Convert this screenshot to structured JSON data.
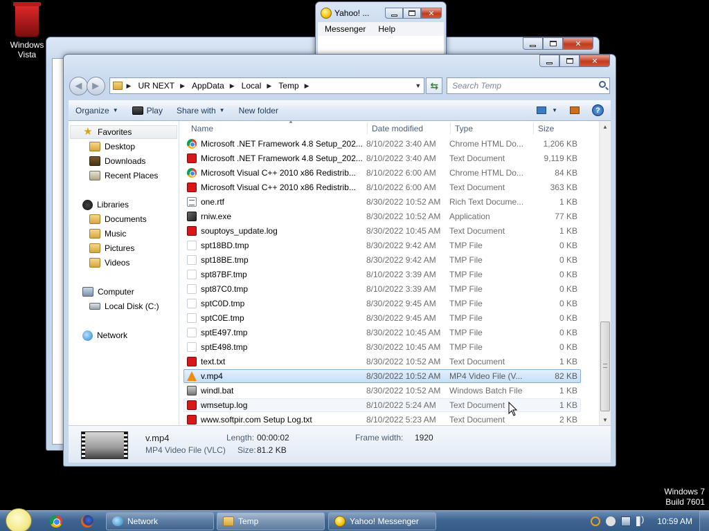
{
  "desktop": {
    "icon_label": "Windows Vista",
    "watermark": [
      "Windows 7",
      "Build 7601"
    ]
  },
  "yahoo_window": {
    "title": "Yahoo! ...",
    "menu": [
      "Messenger",
      "Help"
    ]
  },
  "explorer": {
    "breadcrumb": [
      "UR NEXT",
      "AppData",
      "Local",
      "Temp"
    ],
    "search_placeholder": "Search Temp",
    "toolbar": {
      "organize": "Organize",
      "play": "Play",
      "share_with": "Share with",
      "new_folder": "New folder"
    },
    "nav": {
      "favorites": "Favorites",
      "favorites_items": [
        "Desktop",
        "Downloads",
        "Recent Places"
      ],
      "libraries": "Libraries",
      "libraries_items": [
        "Documents",
        "Music",
        "Pictures",
        "Videos"
      ],
      "computer": "Computer",
      "computer_items": [
        "Local Disk (C:)"
      ],
      "network": "Network"
    },
    "columns": {
      "name": "Name",
      "date": "Date modified",
      "type": "Type",
      "size": "Size"
    },
    "files": [
      {
        "name": "Microsoft .NET Framework 4.8 Setup_202...",
        "date": "8/10/2022 3:40 AM",
        "type": "Chrome HTML Do...",
        "size": "1,206 KB",
        "icon": "chrome-html-icon"
      },
      {
        "name": "Microsoft .NET Framework 4.8 Setup_202...",
        "date": "8/10/2022 3:40 AM",
        "type": "Text Document",
        "size": "9,119 KB",
        "icon": "text-document-icon"
      },
      {
        "name": "Microsoft Visual C++ 2010  x86 Redistrib...",
        "date": "8/10/2022 6:00 AM",
        "type": "Chrome HTML Do...",
        "size": "84 KB",
        "icon": "chrome-html-icon"
      },
      {
        "name": "Microsoft Visual C++ 2010  x86 Redistrib...",
        "date": "8/10/2022 6:00 AM",
        "type": "Text Document",
        "size": "363 KB",
        "icon": "text-document-icon"
      },
      {
        "name": "one.rtf",
        "date": "8/30/2022 10:52 AM",
        "type": "Rich Text Docume...",
        "size": "1 KB",
        "icon": "rtf-icon"
      },
      {
        "name": "rniw.exe",
        "date": "8/30/2022 10:52 AM",
        "type": "Application",
        "size": "77 KB",
        "icon": "application-icon"
      },
      {
        "name": "souptoys_update.log",
        "date": "8/30/2022 10:45 AM",
        "type": "Text Document",
        "size": "1 KB",
        "icon": "text-document-icon"
      },
      {
        "name": "spt18BD.tmp",
        "date": "8/30/2022 9:42 AM",
        "type": "TMP File",
        "size": "0 KB",
        "icon": "tmp-file-icon"
      },
      {
        "name": "spt18BE.tmp",
        "date": "8/30/2022 9:42 AM",
        "type": "TMP File",
        "size": "0 KB",
        "icon": "tmp-file-icon"
      },
      {
        "name": "spt87BF.tmp",
        "date": "8/10/2022 3:39 AM",
        "type": "TMP File",
        "size": "0 KB",
        "icon": "tmp-file-icon"
      },
      {
        "name": "spt87C0.tmp",
        "date": "8/10/2022 3:39 AM",
        "type": "TMP File",
        "size": "0 KB",
        "icon": "tmp-file-icon"
      },
      {
        "name": "sptC0D.tmp",
        "date": "8/30/2022 9:45 AM",
        "type": "TMP File",
        "size": "0 KB",
        "icon": "tmp-file-icon"
      },
      {
        "name": "sptC0E.tmp",
        "date": "8/30/2022 9:45 AM",
        "type": "TMP File",
        "size": "0 KB",
        "icon": "tmp-file-icon"
      },
      {
        "name": "sptE497.tmp",
        "date": "8/30/2022 10:45 AM",
        "type": "TMP File",
        "size": "0 KB",
        "icon": "tmp-file-icon"
      },
      {
        "name": "sptE498.tmp",
        "date": "8/30/2022 10:45 AM",
        "type": "TMP File",
        "size": "0 KB",
        "icon": "tmp-file-icon"
      },
      {
        "name": "text.txt",
        "date": "8/30/2022 10:52 AM",
        "type": "Text Document",
        "size": "1 KB",
        "icon": "text-document-icon"
      },
      {
        "name": "v.mp4",
        "date": "8/30/2022 10:52 AM",
        "type": "MP4 Video File (V...",
        "size": "82 KB",
        "icon": "vlc-icon",
        "selected": true
      },
      {
        "name": "windl.bat",
        "date": "8/30/2022 10:52 AM",
        "type": "Windows Batch File",
        "size": "1 KB",
        "icon": "batch-file-icon"
      },
      {
        "name": "wmsetup.log",
        "date": "8/10/2022 5:24 AM",
        "type": "Text Document",
        "size": "1 KB",
        "icon": "text-document-icon",
        "hovered": true
      },
      {
        "name": "www.softpir.com Setup Log.txt",
        "date": "8/10/2022 5:23 AM",
        "type": "Text Document",
        "size": "2 KB",
        "icon": "text-document-icon"
      }
    ],
    "details": {
      "filename": "v.mp4",
      "filetype": "MP4 Video File (VLC)",
      "length_label": "Length:",
      "length_value": "00:00:02",
      "size_label": "Size:",
      "size_value": "81.2 KB",
      "framewidth_label": "Frame width:",
      "framewidth_value": "1920"
    }
  },
  "taskbar": {
    "tasks": [
      "Network",
      "Temp",
      "Yahoo! Messenger"
    ],
    "clock": "10:59 AM"
  },
  "colors": {
    "selection": "#c5def8",
    "taskbar": "#3f6592",
    "close_button": "#c23a1c"
  }
}
